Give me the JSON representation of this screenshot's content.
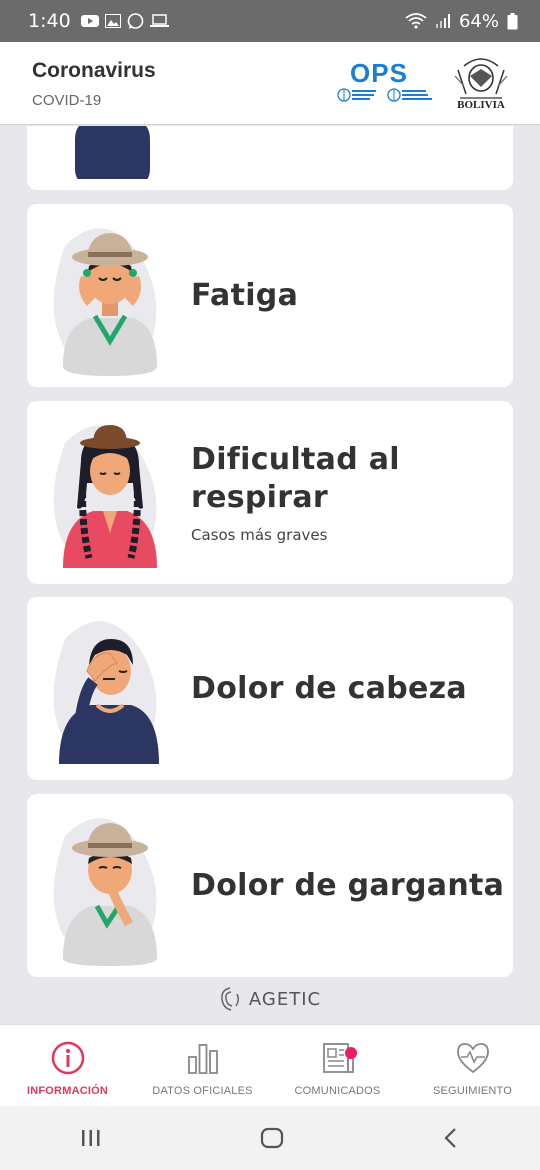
{
  "status_bar": {
    "time": "1:40",
    "battery": "64%",
    "left_icons": [
      "youtube-icon",
      "gallery-icon",
      "whatsapp-icon",
      "laptop-icon"
    ],
    "right_icons": [
      "wifi-icon",
      "signal-icon",
      "battery-icon"
    ]
  },
  "header": {
    "title": "Coronavirus",
    "subtitle": "COVID-19",
    "logo_ops": "OPS",
    "logo_bolivia": "BOLIVIA"
  },
  "symptoms": [
    {
      "label": "",
      "sub": "",
      "illustration": "person-navy-shirt"
    },
    {
      "label": "Fatiga",
      "sub": "",
      "illustration": "person-hat-hands-on-face"
    },
    {
      "label": "Dificultad al respirar",
      "label_lines": [
        "Dificultad al",
        "respirar"
      ],
      "sub": "Casos más graves",
      "illustration": "woman-bowler-hat"
    },
    {
      "label": "Dolor de cabeza",
      "sub": "",
      "illustration": "person-hand-on-head"
    },
    {
      "label": "Dolor de garganta",
      "sub": "",
      "illustration": "person-hat-hand-on-throat"
    }
  ],
  "footer_brand": "AGETIC",
  "bottom_nav": [
    {
      "label": "INFORMACIÓN",
      "icon": "info-icon",
      "active": true
    },
    {
      "label": "DATOS OFICIALES",
      "icon": "bar-chart-icon",
      "active": false
    },
    {
      "label": "COMUNICADOS",
      "icon": "newspaper-icon",
      "active": false,
      "badge": true
    },
    {
      "label": "SEGUIMIENTO",
      "icon": "heart-pulse-icon",
      "active": false
    }
  ],
  "colors": {
    "accent": "#e0385a",
    "badge": "#e91e63",
    "ops_blue": "#1a7fd1",
    "background": "#e8e8ec"
  }
}
